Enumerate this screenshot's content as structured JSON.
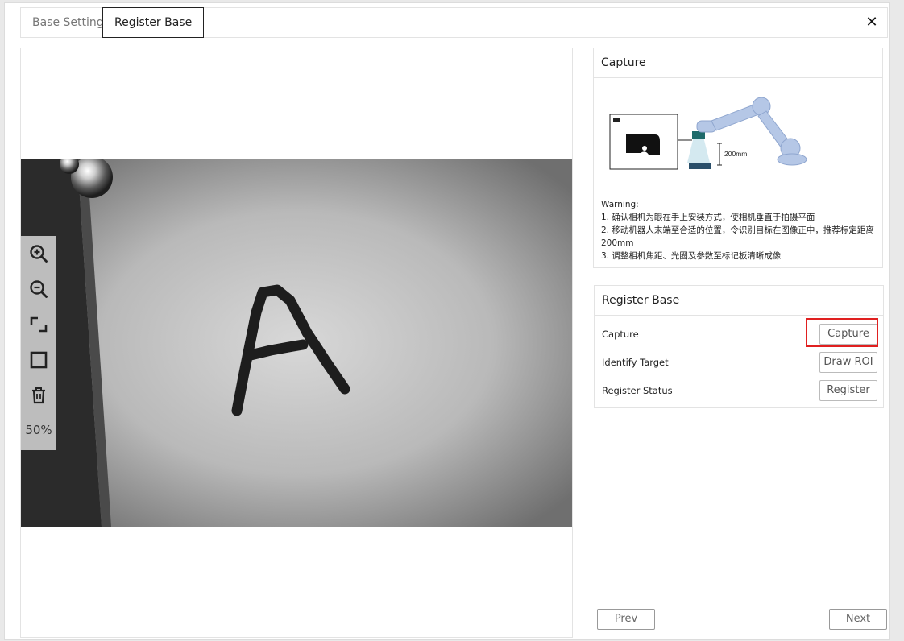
{
  "tabs": [
    {
      "label": "Base Setting",
      "active": false
    },
    {
      "label": "Register Base",
      "active": true
    }
  ],
  "close_icon": "close-icon",
  "viewer": {
    "zoom_level": "50%",
    "tools": [
      "zoom-in-icon",
      "zoom-out-icon",
      "fit-icon",
      "rectangle-icon",
      "trash-icon"
    ],
    "letter": "A"
  },
  "capture_panel": {
    "title": "Capture",
    "diagram_distance": "200mm",
    "warning_title": "Warning:",
    "warning_lines": [
      "1. 确认相机为眼在手上安装方式，使相机垂直于拍摄平面",
      "2. 移动机器人末端至合适的位置，令识别目标在图像正中，推荐标定距离200mm",
      "3. 调整相机焦距、光圈及参数至标记板清晰成像"
    ]
  },
  "register_panel": {
    "title": "Register Base",
    "rows": [
      {
        "label": "Capture",
        "button": "Capture"
      },
      {
        "label": "Identify Target",
        "button": "Draw ROI"
      },
      {
        "label": "Register Status",
        "button": "Register"
      }
    ]
  },
  "footer": {
    "prev": "Prev",
    "next": "Next"
  },
  "colors": {
    "highlight": "#e02020",
    "active_tab_border": "#222222"
  }
}
